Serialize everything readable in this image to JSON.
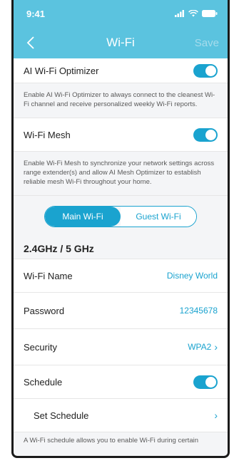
{
  "status": {
    "time": "9:41"
  },
  "nav": {
    "title": "Wi-Fi",
    "save": "Save"
  },
  "optimizer": {
    "label": "AI Wi-Fi Optimizer",
    "description": "Enable AI Wi-Fi Optimizer to always connect to the cleanest Wi-Fi channel and receive personalized weekly Wi-Fi reports.",
    "enabled": true
  },
  "mesh": {
    "label": "Wi-Fi Mesh",
    "description": "Enable Wi-Fi Mesh to synchronize your network settings across range extender(s) and allow AI Mesh Optimizer to establish reliable mesh Wi-Fi throughout your home.",
    "enabled": true
  },
  "segmented": {
    "main": "Main Wi-Fi",
    "guest": "Guest Wi-Fi",
    "selected": "main"
  },
  "band": {
    "header": "2.4GHz / 5 GHz"
  },
  "settings": {
    "wifi_name_label": "Wi-Fi Name",
    "wifi_name_value": "Disney World",
    "password_label": "Password",
    "password_value": "12345678",
    "security_label": "Security",
    "security_value": "WPA2",
    "schedule_label": "Schedule",
    "schedule_enabled": true,
    "set_schedule_label": "Set Schedule"
  },
  "footer": {
    "text": "A Wi-Fi schedule allows you to enable Wi-Fi during certain"
  },
  "colors": {
    "header": "#5bc3df",
    "accent": "#1aa3cf"
  },
  "icons": [
    "signal-icon",
    "wifi-icon",
    "battery-icon",
    "back-chevron-icon",
    "chevron-right-icon"
  ]
}
